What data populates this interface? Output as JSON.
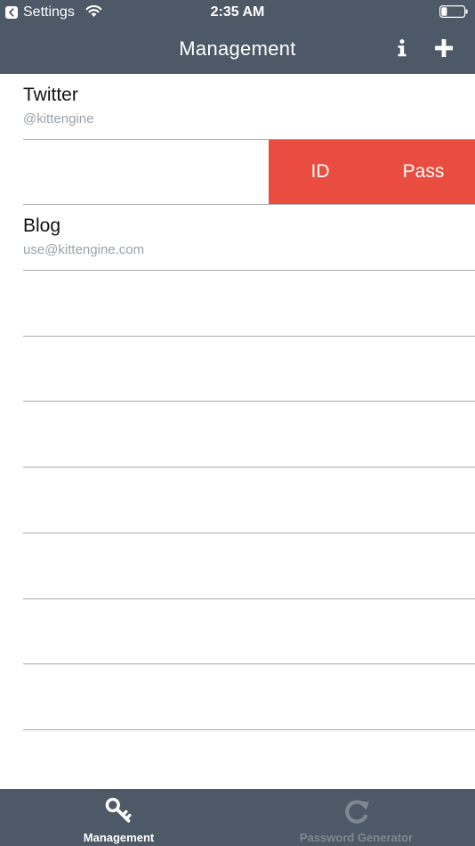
{
  "status_bar": {
    "carrier": "Settings",
    "time": "2:35 AM",
    "back_icon": "back-chevron-icon",
    "wifi_icon": "wifi-icon",
    "battery_icon": "battery-icon",
    "battery_level": 0.25
  },
  "navbar": {
    "title": "Management",
    "info_icon": "info-icon",
    "add_icon": "plus-icon"
  },
  "accounts": [
    {
      "title": "Twitter",
      "subtitle": "@kittengine"
    },
    {
      "title": "",
      "subtitle": "",
      "swiped": true,
      "actions": [
        "ID",
        "Pass"
      ]
    },
    {
      "title": "Blog",
      "subtitle": "use@kittengine.com"
    },
    {
      "title": "",
      "subtitle": ""
    },
    {
      "title": "",
      "subtitle": ""
    },
    {
      "title": "",
      "subtitle": ""
    },
    {
      "title": "",
      "subtitle": ""
    },
    {
      "title": "",
      "subtitle": ""
    },
    {
      "title": "",
      "subtitle": ""
    },
    {
      "title": "",
      "subtitle": ""
    }
  ],
  "tabbar": {
    "tabs": [
      {
        "label": "Management",
        "icon": "key-icon",
        "active": true
      },
      {
        "label": "Password Generator",
        "icon": "refresh-icon",
        "active": false
      }
    ]
  },
  "colors": {
    "bar_background": "#4d5966",
    "swipe_action": "#e94d3f",
    "separator": "#a5a8ab",
    "secondary_text": "#9aa2a9",
    "inactive_tab": "#7f8790"
  }
}
